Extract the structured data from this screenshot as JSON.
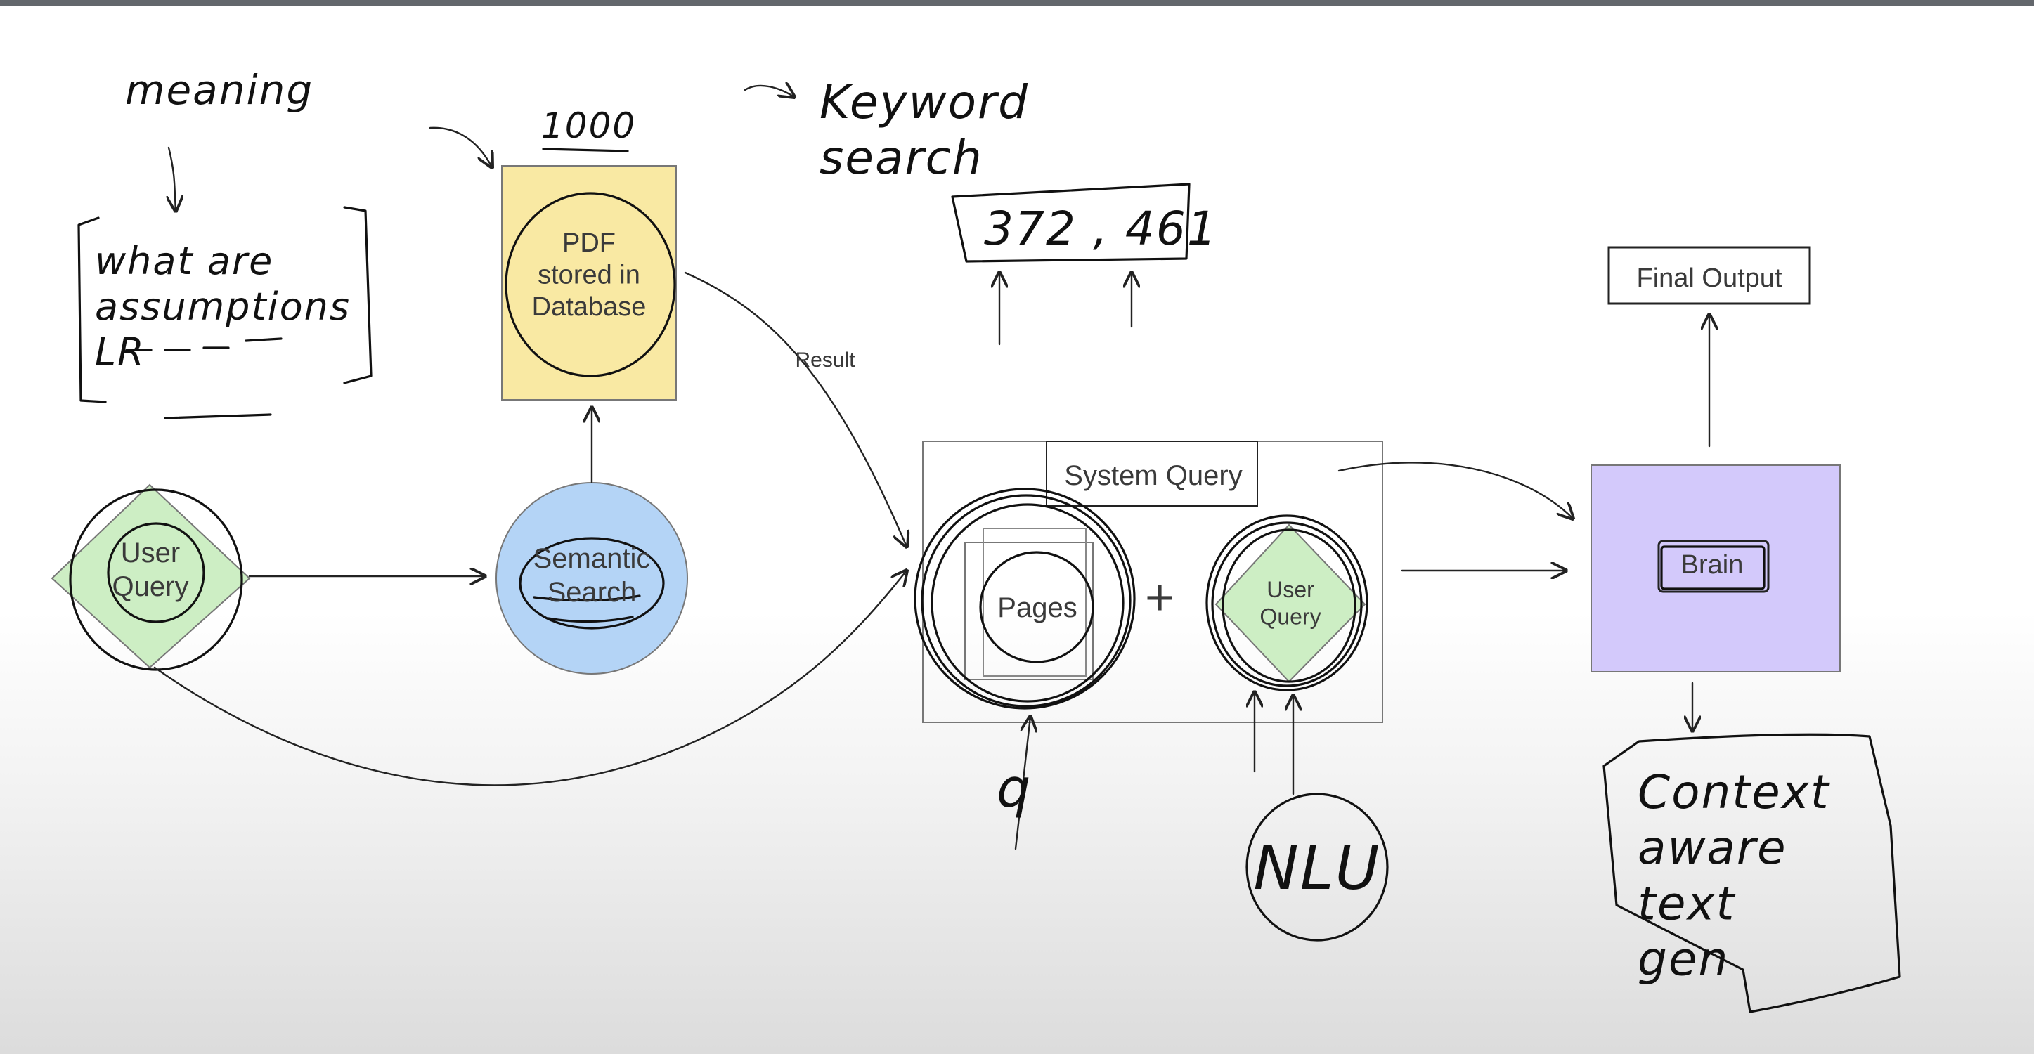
{
  "nodes": {
    "user_query_left": "User\nQuery",
    "semantic_search": "Semantic\nSearch",
    "pdf_database": "PDF\nstored in\nDatabase",
    "system_query": "System Query",
    "pages": "Pages",
    "user_query_inner": "User\nQuery",
    "brain": "Brain",
    "final_output": "Final Output"
  },
  "edge_labels": {
    "result": "Result",
    "plus": "+"
  },
  "annotations": {
    "meaning": "meaning",
    "question": "what are\nassumptions\nLR",
    "count": "1000",
    "keyword_search": "Keyword\nsearch",
    "numbers": "372 , 461",
    "q": "q",
    "nlu": "NLU",
    "context": "Context\naware\ntext\ngen"
  },
  "colors": {
    "green": "#cdeec4",
    "blue": "#b4d4f6",
    "yellow": "#f9e9a3",
    "purple": "#d3c9fb",
    "ink": "#111111",
    "stroke": "#555555"
  }
}
